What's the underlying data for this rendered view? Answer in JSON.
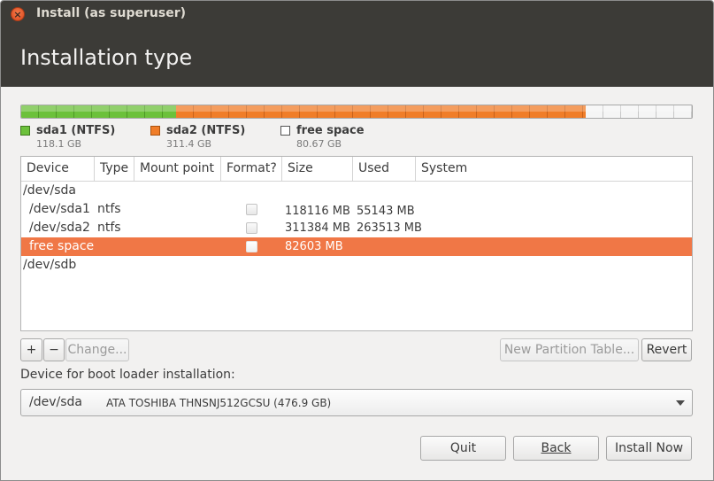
{
  "window": {
    "title": "Install (as superuser)"
  },
  "header": {
    "title": "Installation type"
  },
  "diskbar": {
    "segments": [
      {
        "name": "sda1 (NTFS)",
        "size": "118.1 GB",
        "color": "#6cc13b",
        "fraction": 0.2336
      },
      {
        "name": "sda2 (NTFS)",
        "size": "311.4 GB",
        "color": "#f07d28",
        "fraction": 0.6158
      },
      {
        "name": "free space",
        "size": "80.67 GB",
        "color": "#f5f5f5",
        "fraction": 0.1596
      }
    ]
  },
  "table": {
    "columns": [
      "Device",
      "Type",
      "Mount point",
      "Format?",
      "Size",
      "Used",
      "System"
    ],
    "rows": [
      {
        "device": "/dev/sda",
        "type": "",
        "mount": "",
        "format": null,
        "size": "",
        "used": "",
        "system": ""
      },
      {
        "device": "/dev/sda1",
        "type": "ntfs",
        "mount": "",
        "format": false,
        "size": "118116 MB",
        "used": "55143 MB",
        "system": ""
      },
      {
        "device": "/dev/sda2",
        "type": "ntfs",
        "mount": "",
        "format": false,
        "size": "311384 MB",
        "used": "263513 MB",
        "system": ""
      },
      {
        "device": "free space",
        "type": "",
        "mount": "",
        "format": false,
        "size": "82603 MB",
        "used": "",
        "system": "",
        "selected": true
      },
      {
        "device": "/dev/sdb",
        "type": "",
        "mount": "",
        "format": null,
        "size": "",
        "used": "",
        "system": ""
      }
    ]
  },
  "toolbar": {
    "add_label": "+",
    "remove_label": "−",
    "change_label": "Change...",
    "new_table_label": "New Partition Table...",
    "revert_label": "Revert"
  },
  "bootloader": {
    "label": "Device for boot loader installation:",
    "device": "/dev/sda",
    "description": "ATA TOSHIBA THNSNJ512GCSU (476.9 GB)"
  },
  "footer": {
    "quit_label": "Quit",
    "back_label": "Back",
    "install_label": "Install Now"
  },
  "colors": {
    "header_bg": "#3c3b37",
    "selection": "#f07746",
    "window_bg": "#f2f1f0"
  }
}
